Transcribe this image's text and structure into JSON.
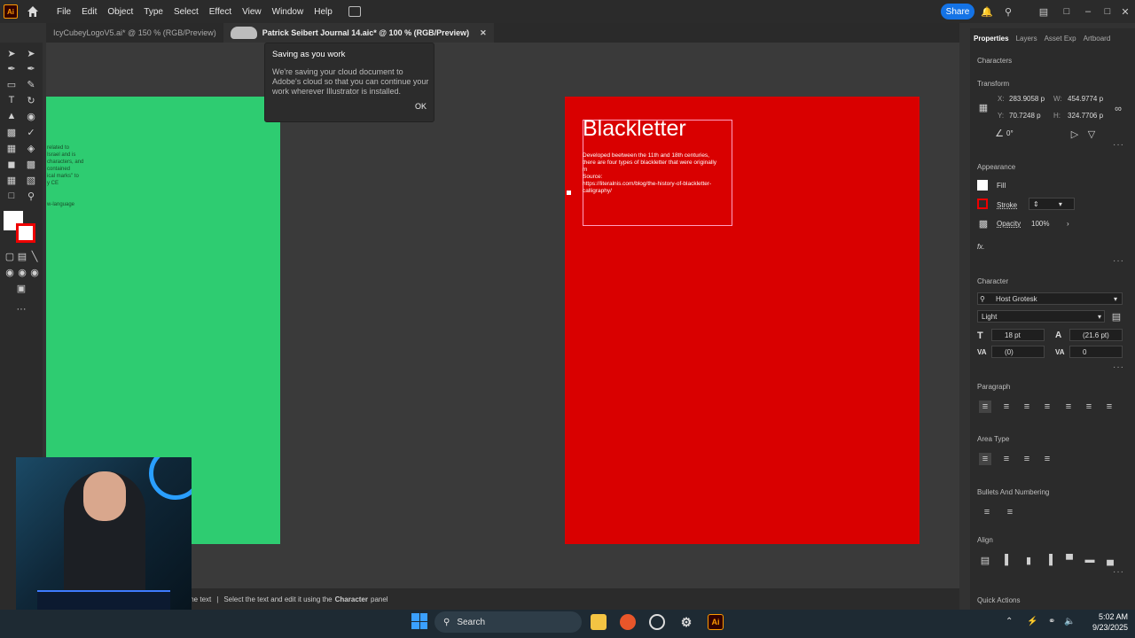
{
  "menubar": {
    "items": [
      "File",
      "Edit",
      "Object",
      "Type",
      "Select",
      "Effect",
      "View",
      "Window",
      "Help"
    ],
    "share_label": "Share",
    "app_logo": "Ai"
  },
  "tabs": [
    {
      "label": "IcyCubeyLogoV5.ai* @ 150 % (RGB/Preview)",
      "active": false
    },
    {
      "label": "Patrick Seibert Journal 14.aic* @ 100 % (RGB/Preview)",
      "active": true
    }
  ],
  "toast": {
    "title": "Saving as you work",
    "body": "We're saving your cloud document to Adobe's cloud so that you can continue your work wherever Illustrator is installed.",
    "ok_label": "OK"
  },
  "artboards": {
    "green": {
      "color": "#2ecc71",
      "text_lines": [
        "related to",
        "Israel and is",
        "characters, and",
        "contained",
        "ical marks\" to",
        "y CE",
        "",
        "w-language"
      ]
    },
    "red": {
      "color": "#d90000",
      "title": "Blackletter",
      "body_lines": [
        "Developed beetween the 11th and 18th centuries,",
        "there are four types of blackletter that were originally",
        "m",
        "Source:",
        "https://literalnis.com/blog/the-history-of-blackletter-",
        "calligraphy/"
      ]
    }
  },
  "status": {
    "text_prefix": "the text",
    "separator": "|",
    "text_main": "Select the text and edit it using the",
    "text_bold": "Character",
    "text_suffix": "panel"
  },
  "panel": {
    "tabs": [
      "Properties",
      "Layers",
      "Asset Exp",
      "Artboard"
    ],
    "characters_label": "Characters",
    "transform": {
      "label": "Transform",
      "x_label": "X:",
      "x": "283.9058 p",
      "y_label": "Y:",
      "y": "70.7248 p",
      "w_label": "W:",
      "w": "454.9774 p",
      "h_label": "H:",
      "h": "324.7706 p",
      "angle": "0°"
    },
    "appearance": {
      "label": "Appearance",
      "fill_label": "Fill",
      "stroke_label": "Stroke",
      "opacity_label": "Opacity",
      "opacity": "100%",
      "fx_label": "fx."
    },
    "character": {
      "label": "Character",
      "font": "Host Grotesk",
      "style": "Light",
      "size": "18 pt",
      "leading": "(21.6 pt)",
      "kerning": "(0)",
      "tracking": "0"
    },
    "paragraph_label": "Paragraph",
    "area_type_label": "Area Type",
    "bullets_label": "Bullets And Numbering",
    "align_label": "Align",
    "quick_actions_label": "Quick Actions"
  },
  "taskbar": {
    "search_label": "Search",
    "time": "5:02 AM",
    "date": "9/23/2025"
  }
}
